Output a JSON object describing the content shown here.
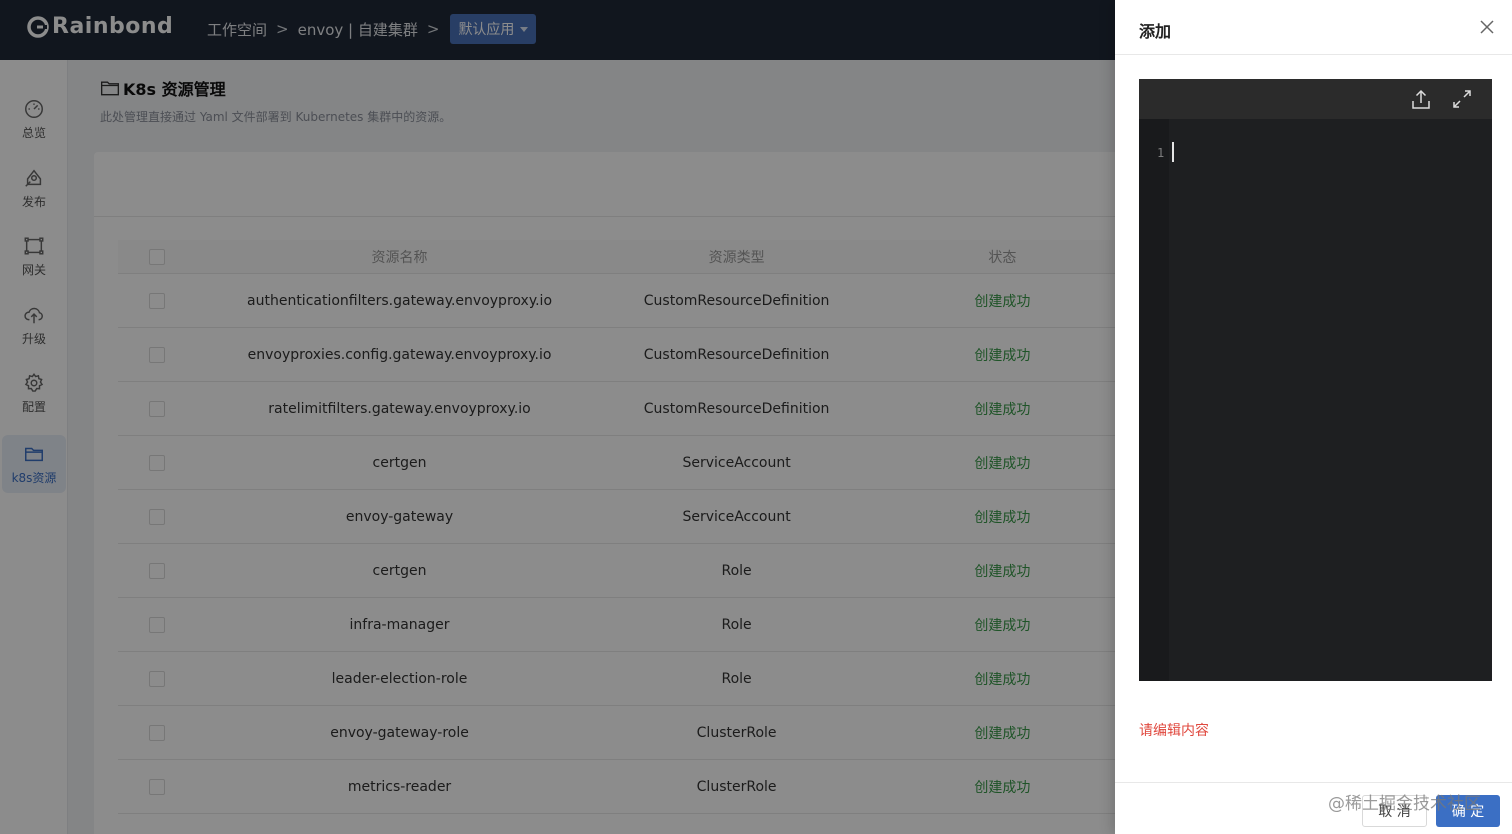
{
  "header": {
    "logo_text": "Rainbond",
    "breadcrumb": [
      "工作空间",
      "envoy | 自建集群"
    ],
    "breadcrumb_sep": ">",
    "app_dropdown": "默认应用"
  },
  "sidebar": {
    "items": [
      {
        "label": "总览",
        "icon": "dashboard-icon"
      },
      {
        "label": "发布",
        "icon": "publish-icon"
      },
      {
        "label": "网关",
        "icon": "gateway-icon"
      },
      {
        "label": "升级",
        "icon": "cloud-upgrade-icon"
      },
      {
        "label": "配置",
        "icon": "gear-icon"
      },
      {
        "label": "k8s资源",
        "icon": "folder-icon",
        "active": true
      }
    ]
  },
  "main": {
    "title": "K8s 资源管理",
    "description": "此处管理直接通过 Yaml 文件部署到 Kubernetes 集群中的资源。",
    "columns": [
      "资源名称",
      "资源类型",
      "状态"
    ],
    "rows": [
      {
        "name": "authenticationfilters.gateway.envoyproxy.io",
        "type": "CustomResourceDefinition",
        "status": "创建成功"
      },
      {
        "name": "envoyproxies.config.gateway.envoyproxy.io",
        "type": "CustomResourceDefinition",
        "status": "创建成功"
      },
      {
        "name": "ratelimitfilters.gateway.envoyproxy.io",
        "type": "CustomResourceDefinition",
        "status": "创建成功"
      },
      {
        "name": "certgen",
        "type": "ServiceAccount",
        "status": "创建成功"
      },
      {
        "name": "envoy-gateway",
        "type": "ServiceAccount",
        "status": "创建成功"
      },
      {
        "name": "certgen",
        "type": "Role",
        "status": "创建成功"
      },
      {
        "name": "infra-manager",
        "type": "Role",
        "status": "创建成功"
      },
      {
        "name": "leader-election-role",
        "type": "Role",
        "status": "创建成功"
      },
      {
        "name": "envoy-gateway-role",
        "type": "ClusterRole",
        "status": "创建成功"
      },
      {
        "name": "metrics-reader",
        "type": "ClusterRole",
        "status": "创建成功"
      }
    ]
  },
  "drawer": {
    "title": "添加",
    "line_number": "1",
    "error": "请编辑内容",
    "cancel_label": "取 消",
    "ok_label": "确 定"
  },
  "watermark": "@稀土掘金技术社区",
  "colors": {
    "header_bg": "#1f2937",
    "accent": "#3b6fc4",
    "success": "#3a9a4a",
    "error": "#e0483e",
    "editor_bg": "#1e1f21"
  }
}
